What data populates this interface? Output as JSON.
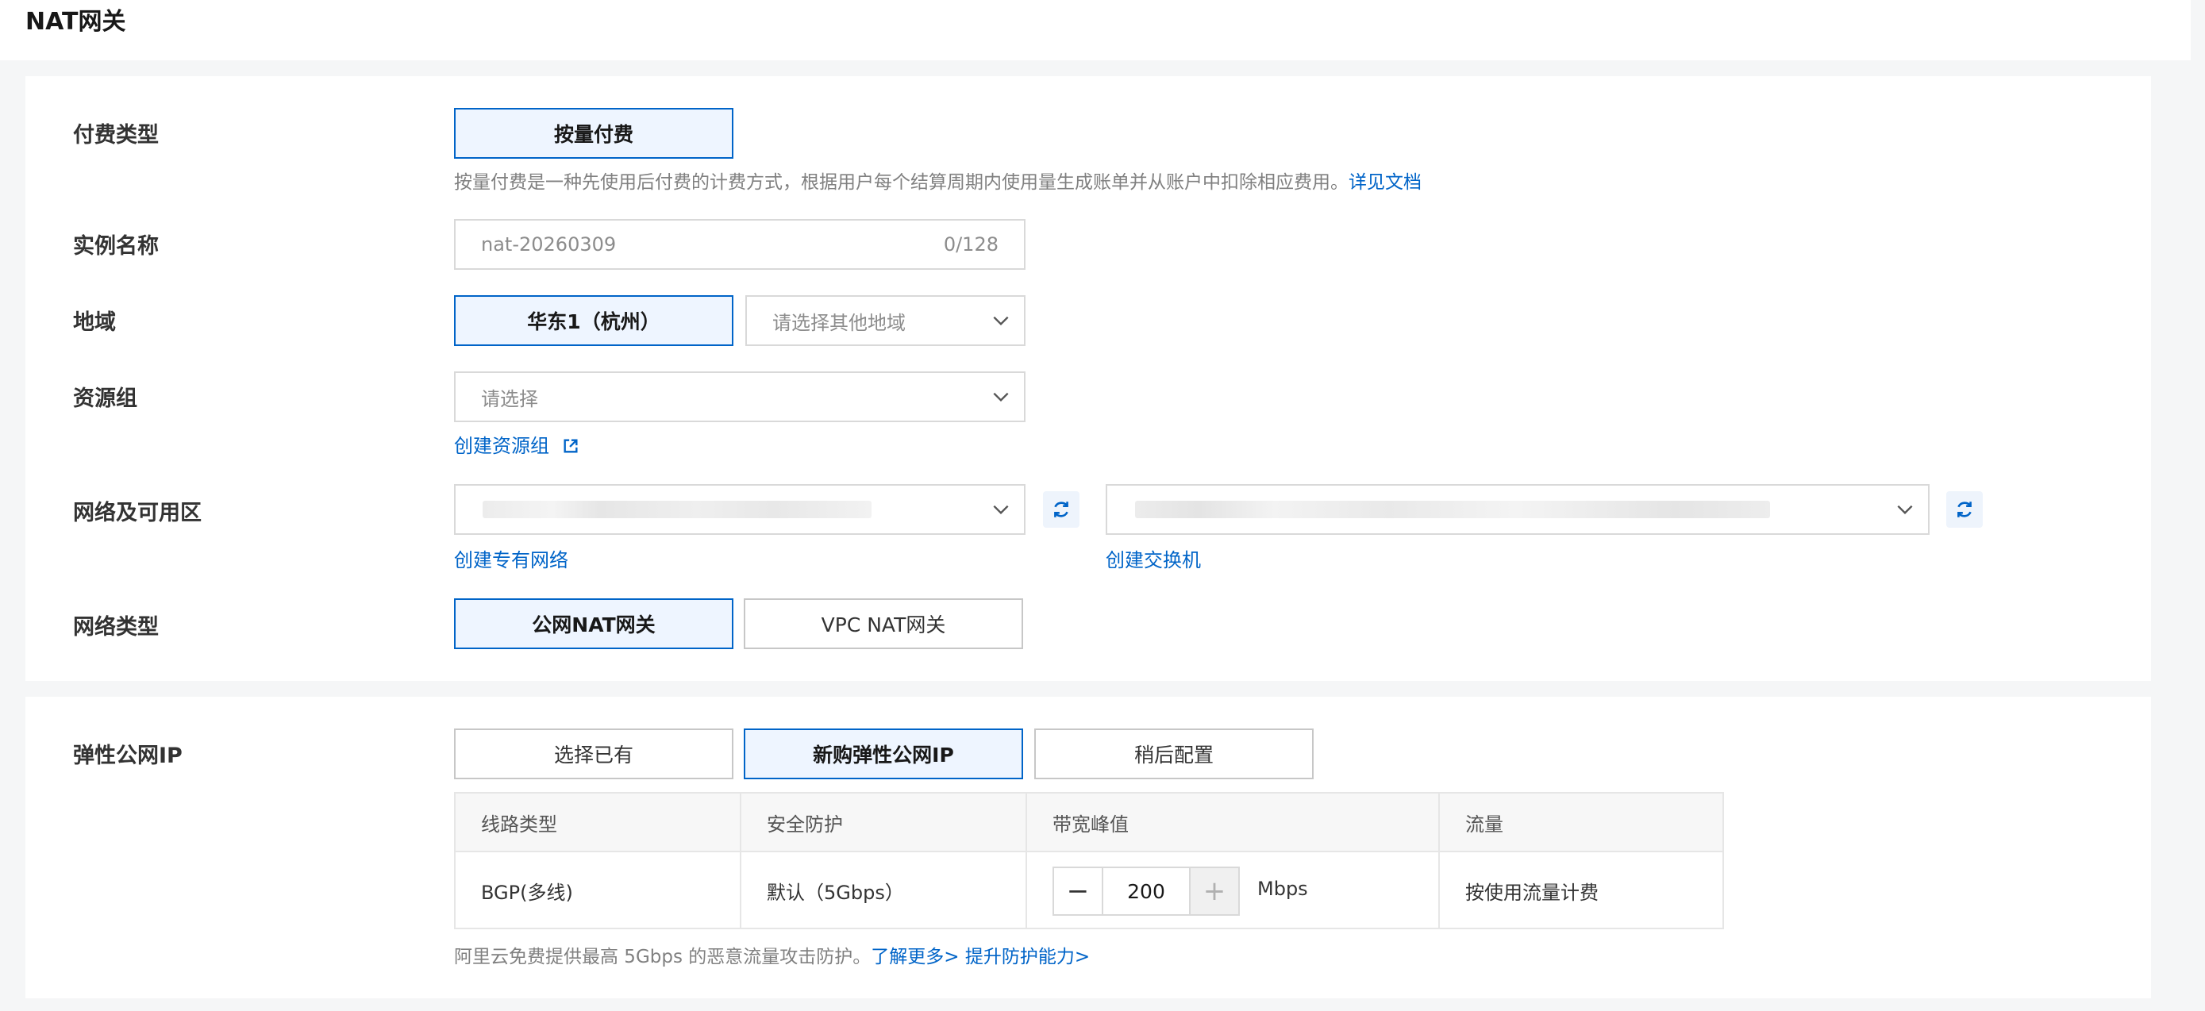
{
  "header": {
    "title": "NAT网关"
  },
  "billing": {
    "label": "付费类型",
    "option": "按量付费",
    "hint": "按量付费是一种先使用后付费的计费方式，根据用户每个结算周期内使用量生成账单并从账户中扣除相应费用。",
    "hint_link": "详见文档"
  },
  "instance": {
    "label": "实例名称",
    "placeholder": "nat-20260309",
    "counter": "0/128"
  },
  "region": {
    "label": "地域",
    "selected": "华东1（杭州）",
    "other_placeholder": "请选择其他地域"
  },
  "resource_group": {
    "label": "资源组",
    "placeholder": "请选择",
    "create_link": "创建资源组"
  },
  "network": {
    "label": "网络及可用区",
    "create_vpc_link": "创建专有网络",
    "create_vswitch_link": "创建交换机"
  },
  "network_type": {
    "label": "网络类型",
    "options": [
      "公网NAT网关",
      "VPC NAT网关"
    ],
    "selected": "公网NAT网关"
  },
  "eip": {
    "label": "弹性公网IP",
    "options": [
      "选择已有",
      "新购弹性公网IP",
      "稍后配置"
    ],
    "selected": "新购弹性公网IP",
    "table": {
      "headers": [
        "线路类型",
        "安全防护",
        "带宽峰值",
        "流量"
      ],
      "row": {
        "line_type": "BGP(多线)",
        "protection": "默认（5Gbps）",
        "bandwidth": "200",
        "unit": "Mbps",
        "traffic": "按使用流量计费"
      }
    },
    "note": "阿里云免费提供最高 5Gbps 的恶意流量攻击防护。",
    "learn_more": "了解更多>",
    "upgrade": "提升防护能力>"
  },
  "colors": {
    "accent": "#0064c8",
    "selected_bg": "#eef5ff",
    "page_bg": "#f5f6f7"
  },
  "icons": {
    "select_arrow": "chevron-down-icon",
    "refresh": "refresh-icon",
    "external_link": "external-link-icon"
  }
}
